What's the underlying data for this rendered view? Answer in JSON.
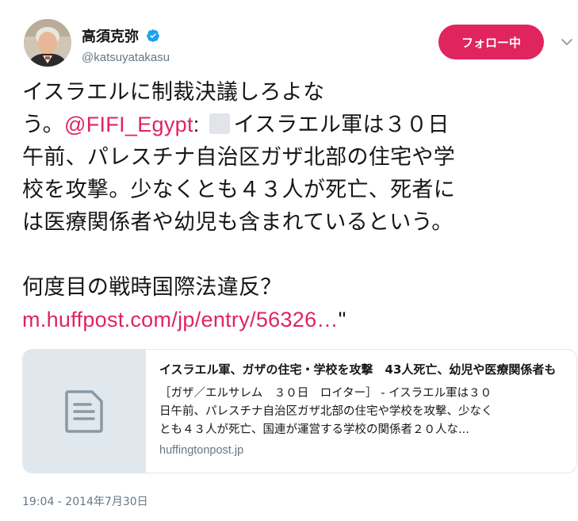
{
  "user": {
    "display_name": "高須克弥",
    "handle": "@katsuyatakasu",
    "verified": true
  },
  "follow_button": {
    "label": "フォロー中",
    "color": "#e0245e"
  },
  "tweet": {
    "line1": "イスラエルに制裁決議しろよな",
    "line2_prefix": "う。",
    "mention": "@FIFI_Egypt",
    "line2_after_mention": ":",
    "line2_rest": "イスラエル軍は３０日",
    "line3": "午前、パレスチナ自治区ガザ北部の住宅や学",
    "line4": "校を攻撃。少なくとも４３人が死亡、死者に",
    "line5": "は医療関係者や幼児も含まれているという。",
    "line6": "何度目の戦時国際法違反？",
    "link": "m.huffpost.com/jp/entry/56326…",
    "closing_quote": "\""
  },
  "card": {
    "title": "イスラエル軍、ガザの住宅・学校を攻撃　43人死亡、幼児や医療関係者も",
    "desc_line1": "［ガザ／エルサレム　３０日　ロイター］ - イスラエル軍は３０",
    "desc_line2": "日午前、パレスチナ自治区ガザ北部の住宅や学校を攻撃、少なく",
    "desc_line3": "とも４３人が死亡、国連が運営する学校の関係者２０人な...",
    "domain": "huffingtonpost.jp",
    "thumb_icon": "document-icon"
  },
  "timestamp": "19:04 - 2014年7月30日",
  "colors": {
    "accent": "#e0245e",
    "verified": "#1da1f2",
    "muted": "#657786"
  }
}
